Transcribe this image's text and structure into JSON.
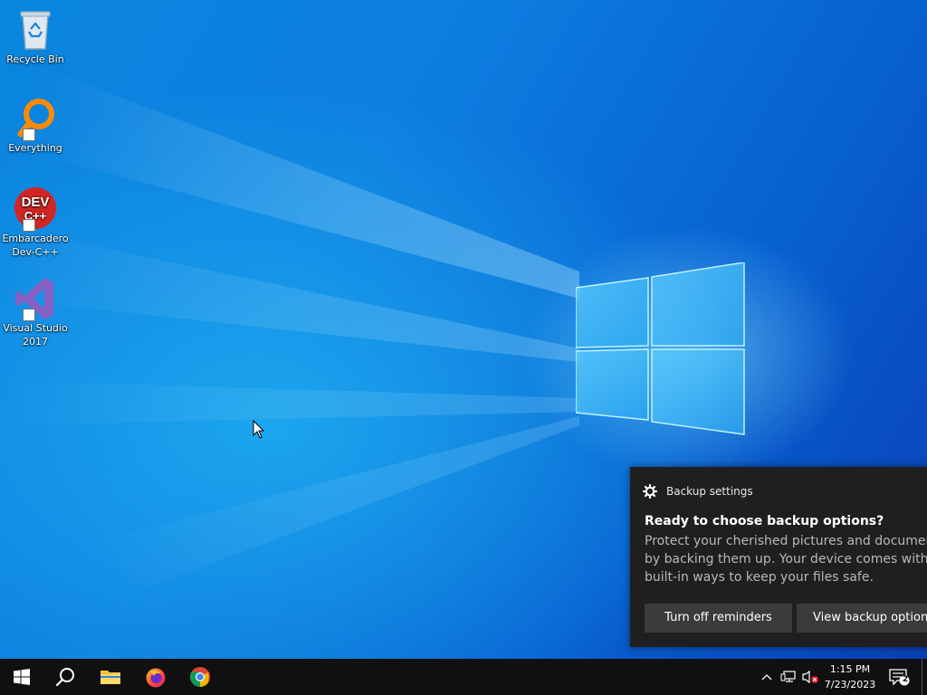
{
  "desktop": {
    "icons": [
      {
        "label": "Recycle Bin",
        "icon": "recycle-bin-icon"
      },
      {
        "label": "Everything",
        "icon": "everything-search-icon"
      },
      {
        "label": "Embarcadero Dev-C++",
        "icon": "dev-cpp-icon",
        "logo_text_1": "DEV",
        "logo_text_2": "C++"
      },
      {
        "label": "Visual Studio 2017",
        "icon": "visual-studio-icon"
      }
    ]
  },
  "notification": {
    "app_name": "Backup settings",
    "app_icon": "gear-icon",
    "title": "Ready to choose backup options?",
    "body_lines": [
      "Protect your cherished pictures and documents",
      "by backing them up. Your device comes with",
      "built-in ways to keep your files safe."
    ],
    "buttons": {
      "turn_off": "Turn off reminders",
      "view": "View backup options"
    }
  },
  "taskbar": {
    "items": [
      {
        "name": "start",
        "icon": "windows-start-icon"
      },
      {
        "name": "search",
        "icon": "search-icon"
      },
      {
        "name": "file-explorer",
        "icon": "folder-icon"
      },
      {
        "name": "firefox",
        "icon": "firefox-icon"
      },
      {
        "name": "chrome",
        "icon": "chrome-icon"
      }
    ],
    "tray": {
      "chevron_icon": "chevron-up-icon",
      "network_icon": "network-icon",
      "volume_icon": "volume-muted-icon",
      "time": "1:15 PM",
      "date": "7/23/2023",
      "action_center_icon": "action-center-icon",
      "notification_count": "2"
    }
  },
  "colors": {
    "desktop_blue": "#0a7fdf",
    "taskbar": "#101010",
    "toast_bg": "#1f1f1f",
    "toast_button": "#3b3b3b",
    "chrome_red": "#db4437",
    "chrome_yellow": "#f4b400",
    "chrome_green": "#0f9d58",
    "chrome_blue": "#4285f4"
  }
}
